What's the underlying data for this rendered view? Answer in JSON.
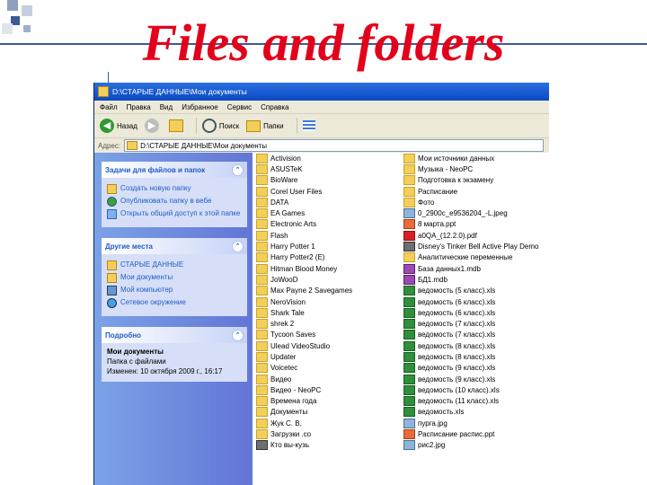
{
  "slide": {
    "title": "Files and folders"
  },
  "window": {
    "title": "D:\\СТАРЫЕ ДАННЫЕ\\Мои документы",
    "menu": [
      "Файл",
      "Правка",
      "Вид",
      "Избранное",
      "Сервис",
      "Справка"
    ],
    "toolbar": {
      "back": "Назад",
      "search": "Поиск",
      "folders": "Папки"
    },
    "address": {
      "label": "Адрес:",
      "value": "D:\\СТАРЫЕ ДАННЫЕ\\Мои документы"
    }
  },
  "sidebar": {
    "tasks": {
      "title": "Задачи для файлов и папок",
      "items": [
        "Создать новую папку",
        "Опубликовать папку в вебе",
        "Открыть общий доступ к этой папке"
      ]
    },
    "places": {
      "title": "Другие места",
      "items": [
        "СТАРЫЕ ДАННЫЕ",
        "Мои документы",
        "Мой компьютер",
        "Сетевое окружение"
      ]
    },
    "details": {
      "title": "Подробно",
      "name": "Мои документы",
      "type": "Папка с файлами",
      "modified": "Изменен: 10 октября 2009 г., 16:17"
    }
  },
  "files": {
    "col1": [
      {
        "name": "Activision",
        "icon": "folder"
      },
      {
        "name": "ASUSTeK",
        "icon": "folder"
      },
      {
        "name": "BioWare",
        "icon": "folder"
      },
      {
        "name": "Corel User Files",
        "icon": "folder"
      },
      {
        "name": "DATA",
        "icon": "folder"
      },
      {
        "name": "EA Games",
        "icon": "folder"
      },
      {
        "name": "Electronic Arts",
        "icon": "folder"
      },
      {
        "name": "Flash",
        "icon": "folder"
      },
      {
        "name": "Harry Potter 1",
        "icon": "folder"
      },
      {
        "name": "Harry Potter2 (E)",
        "icon": "folder"
      },
      {
        "name": "Hitman Blood Money",
        "icon": "folder"
      },
      {
        "name": "JoWooD",
        "icon": "folder"
      },
      {
        "name": "Max Payne 2 Savegames",
        "icon": "folder"
      },
      {
        "name": "NeroVision",
        "icon": "folder"
      },
      {
        "name": "Shark Tale",
        "icon": "folder"
      },
      {
        "name": "shrek 2",
        "icon": "folder"
      },
      {
        "name": "Tycoon Saves",
        "icon": "folder"
      },
      {
        "name": "Ulead VideoStudio",
        "icon": "folder"
      },
      {
        "name": "Updater",
        "icon": "folder"
      },
      {
        "name": "Voicetec",
        "icon": "folder"
      },
      {
        "name": "Видео",
        "icon": "folder"
      },
      {
        "name": "Видео - NeoPC",
        "icon": "folder"
      },
      {
        "name": "Времена года",
        "icon": "folder"
      },
      {
        "name": "Документы",
        "icon": "folder"
      },
      {
        "name": "Жук С. В.",
        "icon": "folder"
      },
      {
        "name": "Загрузки .co",
        "icon": "folder"
      },
      {
        "name": "Кто вы-кузь",
        "icon": "exe"
      }
    ],
    "col2": [
      {
        "name": "Мои источники данных",
        "icon": "folder"
      },
      {
        "name": "Музыка - NeoPC",
        "icon": "folder"
      },
      {
        "name": "Подготовка к экзамену",
        "icon": "folder"
      },
      {
        "name": "Расписание",
        "icon": "folder"
      },
      {
        "name": "Фото",
        "icon": "folder"
      },
      {
        "name": "0_2900c_e9536204_-L.jpeg",
        "icon": "image"
      },
      {
        "name": "8 марта.ppt",
        "icon": "ppt"
      },
      {
        "name": "a0QA_(12.2.0).pdf",
        "icon": "pdf"
      },
      {
        "name": "Disney's Tinker Bell Active Play Demo",
        "icon": "exe"
      },
      {
        "name": "Аналитические переменные",
        "icon": "folder"
      },
      {
        "name": "База данных1.mdb",
        "icon": "mdb"
      },
      {
        "name": "БД1.mdb",
        "icon": "mdb"
      },
      {
        "name": "ведомость (5 класс).xls",
        "icon": "xls"
      },
      {
        "name": "ведомость (6 класс).xls",
        "icon": "xls"
      },
      {
        "name": "ведомость (6 класс).xls",
        "icon": "xls"
      },
      {
        "name": "ведомость (7 класс).xls",
        "icon": "xls"
      },
      {
        "name": "ведомость (7 класс).xls",
        "icon": "xls"
      },
      {
        "name": "ведомость (8 класс).xls",
        "icon": "xls"
      },
      {
        "name": "ведомость (8 класс).xls",
        "icon": "xls"
      },
      {
        "name": "ведомость (9 класс).xls",
        "icon": "xls"
      },
      {
        "name": "ведомость (9 класс).xls",
        "icon": "xls"
      },
      {
        "name": "ведомость (10 класс).xls",
        "icon": "xls"
      },
      {
        "name": "ведомость (11 класс).xls",
        "icon": "xls"
      },
      {
        "name": "ведомость.xls",
        "icon": "xls"
      },
      {
        "name": "пурга.jpg",
        "icon": "image"
      },
      {
        "name": "Расписание распис.ppt",
        "icon": "ppt"
      },
      {
        "name": "рис2.jpg",
        "icon": "image"
      }
    ]
  }
}
